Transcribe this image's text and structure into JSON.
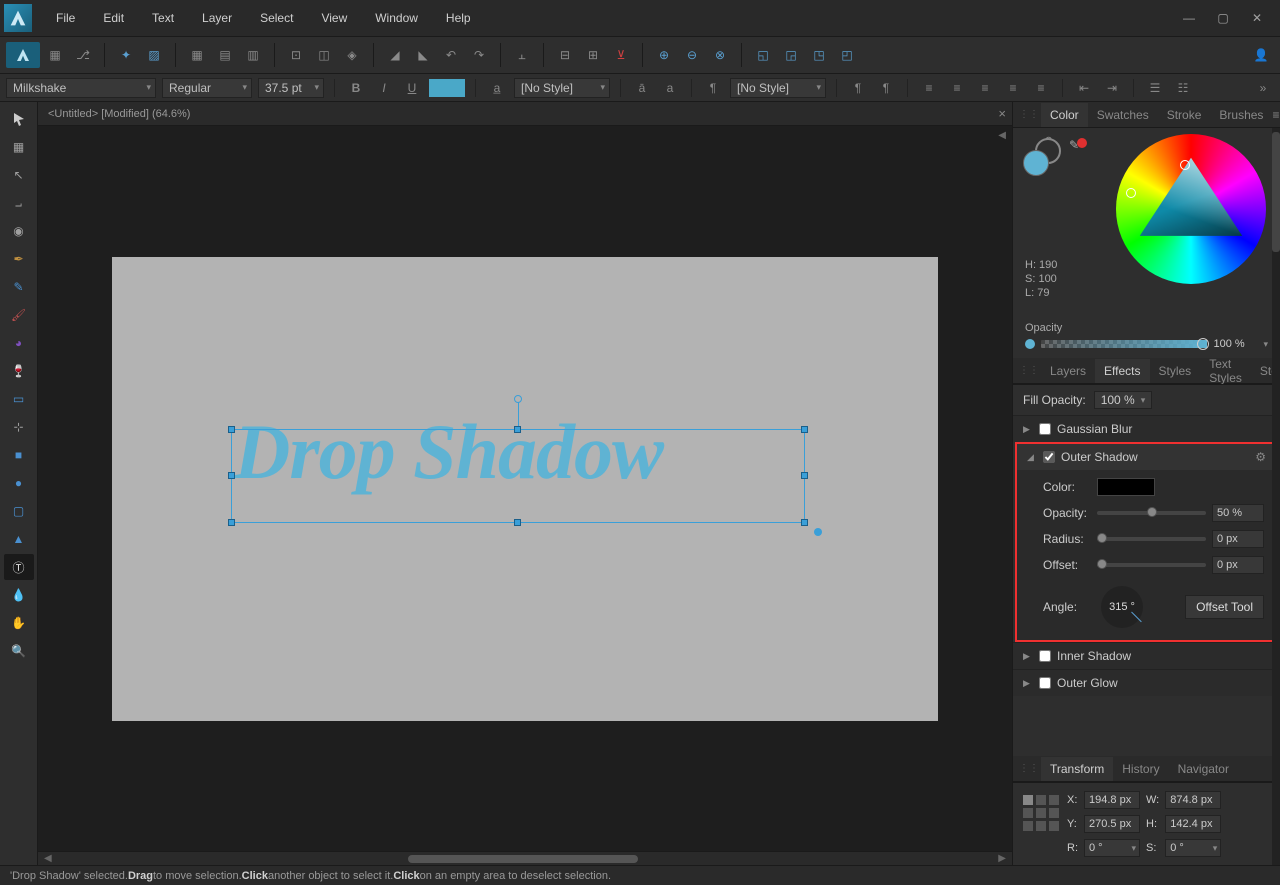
{
  "menu": [
    "File",
    "Edit",
    "Text",
    "Layer",
    "Select",
    "View",
    "Window",
    "Help"
  ],
  "context": {
    "font_family": "Milkshake",
    "font_style": "Regular",
    "font_size": "37.5 pt",
    "char_style": "[No Style]",
    "para_style": "[No Style]"
  },
  "doc": {
    "title": "<Untitled> [Modified] (64.6%)",
    "canvas_text": "Drop Shadow"
  },
  "color_panel": {
    "tabs": [
      "Color",
      "Swatches",
      "Stroke",
      "Brushes"
    ],
    "active_tab": "Color",
    "hsl": {
      "h": "H: 190",
      "s": "S: 100",
      "l": "L: 79"
    },
    "opacity_label": "Opacity",
    "opacity_value": "100 %"
  },
  "layers_tabs": [
    "Layers",
    "Effects",
    "Styles",
    "Text Styles",
    "Stock"
  ],
  "layers_active": "Effects",
  "effects": {
    "fill_opacity_label": "Fill Opacity:",
    "fill_opacity_value": "100 %",
    "gaussian": "Gaussian Blur",
    "outer_shadow": {
      "label": "Outer Shadow",
      "color_label": "Color:",
      "opacity_label": "Opacity:",
      "opacity_value": "50 %",
      "radius_label": "Radius:",
      "radius_value": "0 px",
      "offset_label": "Offset:",
      "offset_value": "0 px",
      "angle_label": "Angle:",
      "angle_value": "315 °",
      "offset_tool": "Offset Tool"
    },
    "inner_shadow": "Inner Shadow",
    "outer_glow": "Outer Glow"
  },
  "transform": {
    "tabs": [
      "Transform",
      "History",
      "Navigator"
    ],
    "x_label": "X:",
    "x": "194.8 px",
    "w_label": "W:",
    "w": "874.8 px",
    "y_label": "Y:",
    "y": "270.5 px",
    "h_label": "H:",
    "h": "142.4 px",
    "r_label": "R:",
    "r": "0 °",
    "s_label": "S:",
    "s": "0 °"
  },
  "status": {
    "prefix": "'Drop Shadow' selected. ",
    "b1": "Drag",
    "t1": " to move selection. ",
    "b2": "Click",
    "t2": " another object to select it. ",
    "b3": "Click",
    "t3": " on an empty area to deselect selection."
  }
}
